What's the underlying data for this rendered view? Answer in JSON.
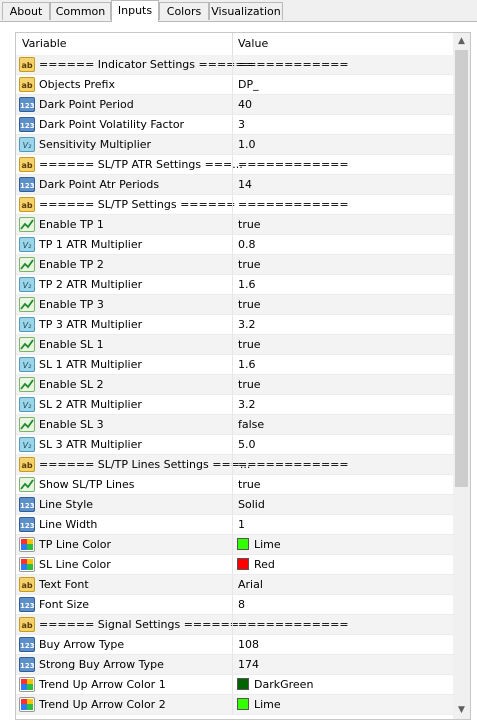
{
  "tabs": [
    {
      "label": "About"
    },
    {
      "label": "Common"
    },
    {
      "label": "Inputs"
    },
    {
      "label": "Colors"
    },
    {
      "label": "Visualization"
    }
  ],
  "active_tab": "Inputs",
  "header": {
    "variable": "Variable",
    "value": "Value"
  },
  "colors": {
    "Lime": "#33ff00",
    "Red": "#ff0000",
    "DarkGreen": "#006400"
  },
  "rows": [
    {
      "icon": "string-icon",
      "name": "====== Indicator Settings ======",
      "value": "============"
    },
    {
      "icon": "string-icon",
      "name": "Objects Prefix",
      "value": "DP_"
    },
    {
      "icon": "integer-icon",
      "name": "Dark Point Period",
      "value": "40"
    },
    {
      "icon": "integer-icon",
      "name": "Dark Point Volatility Factor",
      "value": "3"
    },
    {
      "icon": "double-icon",
      "name": "Sensitivity Multiplier",
      "value": "1.0"
    },
    {
      "icon": "string-icon",
      "name": "====== SL/TP ATR Settings ===...",
      "value": "============"
    },
    {
      "icon": "integer-icon",
      "name": "Dark Point Atr Periods",
      "value": "14"
    },
    {
      "icon": "string-icon",
      "name": "====== SL/TP Settings ======",
      "value": "============"
    },
    {
      "icon": "bool-icon",
      "name": "Enable TP 1",
      "value": "true"
    },
    {
      "icon": "double-icon",
      "name": "TP 1 ATR Multiplier",
      "value": "0.8"
    },
    {
      "icon": "bool-icon",
      "name": "Enable TP 2",
      "value": "true"
    },
    {
      "icon": "double-icon",
      "name": "TP 2 ATR Multiplier",
      "value": "1.6"
    },
    {
      "icon": "bool-icon",
      "name": "Enable TP 3",
      "value": "true"
    },
    {
      "icon": "double-icon",
      "name": "TP 3 ATR Multiplier",
      "value": "3.2"
    },
    {
      "icon": "bool-icon",
      "name": "Enable SL 1",
      "value": "true"
    },
    {
      "icon": "double-icon",
      "name": "SL 1 ATR Multiplier",
      "value": "1.6"
    },
    {
      "icon": "bool-icon",
      "name": "Enable SL 2",
      "value": "true"
    },
    {
      "icon": "double-icon",
      "name": "SL 2 ATR Multiplier",
      "value": "3.2"
    },
    {
      "icon": "bool-icon",
      "name": "Enable SL 3",
      "value": "false"
    },
    {
      "icon": "double-icon",
      "name": "SL 3 ATR Multiplier",
      "value": "5.0"
    },
    {
      "icon": "string-icon",
      "name": "====== SL/TP Lines Settings ===...",
      "value": "============"
    },
    {
      "icon": "bool-icon",
      "name": "Show SL/TP Lines",
      "value": "true"
    },
    {
      "icon": "integer-icon",
      "name": "Line Style",
      "value": "Solid"
    },
    {
      "icon": "integer-icon",
      "name": "Line Width",
      "value": "1"
    },
    {
      "icon": "color-icon",
      "name": "TP Line Color",
      "value": "Lime",
      "swatch": "#33ff00"
    },
    {
      "icon": "color-icon",
      "name": "SL Line Color",
      "value": "Red",
      "swatch": "#ff0000"
    },
    {
      "icon": "string-icon",
      "name": "Text Font",
      "value": "Arial"
    },
    {
      "icon": "integer-icon",
      "name": "Font Size",
      "value": "8"
    },
    {
      "icon": "string-icon",
      "name": "====== Signal Settings ======",
      "value": "============"
    },
    {
      "icon": "integer-icon",
      "name": "Buy Arrow Type",
      "value": "108"
    },
    {
      "icon": "integer-icon",
      "name": "Strong Buy Arrow Type",
      "value": "174"
    },
    {
      "icon": "color-icon",
      "name": "Trend Up Arrow Color 1",
      "value": "DarkGreen",
      "swatch": "#006400"
    },
    {
      "icon": "color-icon",
      "name": "Trend Up Arrow Color 2",
      "value": "Lime",
      "swatch": "#33ff00"
    }
  ]
}
